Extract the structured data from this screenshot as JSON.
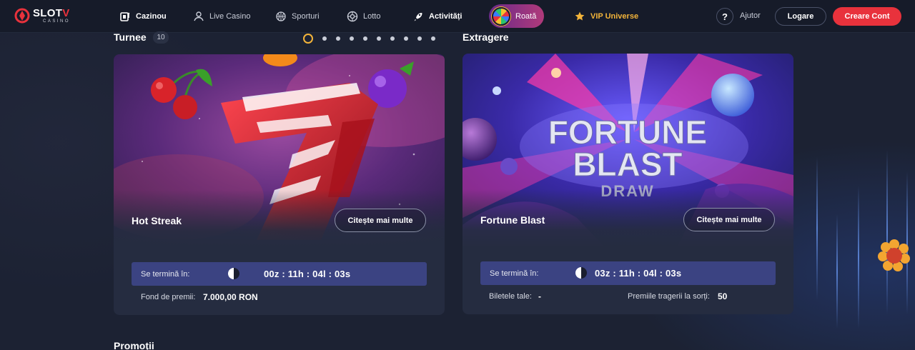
{
  "nav": {
    "logo_main": "SLOT",
    "logo_accent": "V",
    "logo_sub": "CASINO",
    "items": [
      {
        "label": "Cazinou",
        "icon": "casino-icon"
      },
      {
        "label": "Live Casino",
        "icon": "live-dealer-icon"
      },
      {
        "label": "Sporturi",
        "icon": "basketball-icon"
      },
      {
        "label": "Lotto",
        "icon": "lotto-ball-icon"
      },
      {
        "label": "Activități",
        "icon": "rocket-icon"
      },
      {
        "label": "Roată",
        "icon": "wheel-icon"
      },
      {
        "label": "VIP Universe",
        "icon": "star-icon"
      }
    ],
    "help_symbol": "?",
    "help_label": "Ajutor",
    "login_label": "Logare",
    "register_label": "Creare Cont"
  },
  "tournaments": {
    "title": "Turnee",
    "count": "10",
    "carousel_dots": 10,
    "active_dot": 0,
    "card": {
      "name": "Hot Streak",
      "read_more": "Citește mai multe",
      "ends_label": "Se termină în:",
      "countdown": "00z : 11h : 04l : 03s",
      "prize_label": "Fond de premii:",
      "prize_value": "7.000,00 RON"
    }
  },
  "draws": {
    "title": "Extragere",
    "card": {
      "banner_line1": "FORTUNE",
      "banner_line2": "BLAST",
      "banner_line3": "DRAW",
      "name": "Fortune Blast",
      "read_more": "Citește mai multe",
      "ends_label": "Se termină în:",
      "countdown": "03z : 11h : 04l : 03s",
      "tickets_label": "Biletele tale:",
      "tickets_value": "-",
      "prizes_label": "Premiile tragerii la sorți:",
      "prizes_value": "50"
    }
  },
  "promotions": {
    "title": "Promoții"
  },
  "colors": {
    "background": "#1c2233",
    "nav": "#161b29",
    "card": "#252c40",
    "accent_red": "#e8323c",
    "timer_bar": "#3b4382",
    "vip_gold": "#f3b43a"
  }
}
